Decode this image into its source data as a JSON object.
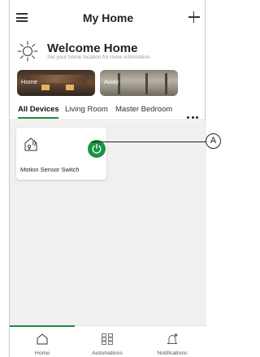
{
  "header": {
    "title": "My Home",
    "menu_icon": "hamburger-menu-icon",
    "add_icon": "plus-icon"
  },
  "welcome": {
    "title": "Welcome Home",
    "subtitle": "Set your home location for more information.",
    "weather_icon": "sun-icon"
  },
  "modes": [
    {
      "label": "Home"
    },
    {
      "label": "Away"
    }
  ],
  "tabs": [
    {
      "label": "All Devices",
      "active": true
    },
    {
      "label": "Living Room",
      "active": false
    },
    {
      "label": "Master Bedroom",
      "active": false
    }
  ],
  "devices": [
    {
      "name": "Motion Sensor Switch",
      "icon": "motion-sensor-icon",
      "power_state": "on"
    }
  ],
  "callout": {
    "label": "A"
  },
  "bottom_nav": [
    {
      "label": "Home",
      "icon": "home-icon",
      "active": true
    },
    {
      "label": "Automations",
      "icon": "grid-icon",
      "active": false
    },
    {
      "label": "Notifications",
      "icon": "bell-icon",
      "active": false
    }
  ],
  "colors": {
    "accent": "#1a9343",
    "content_background": "#f0f0f0"
  }
}
